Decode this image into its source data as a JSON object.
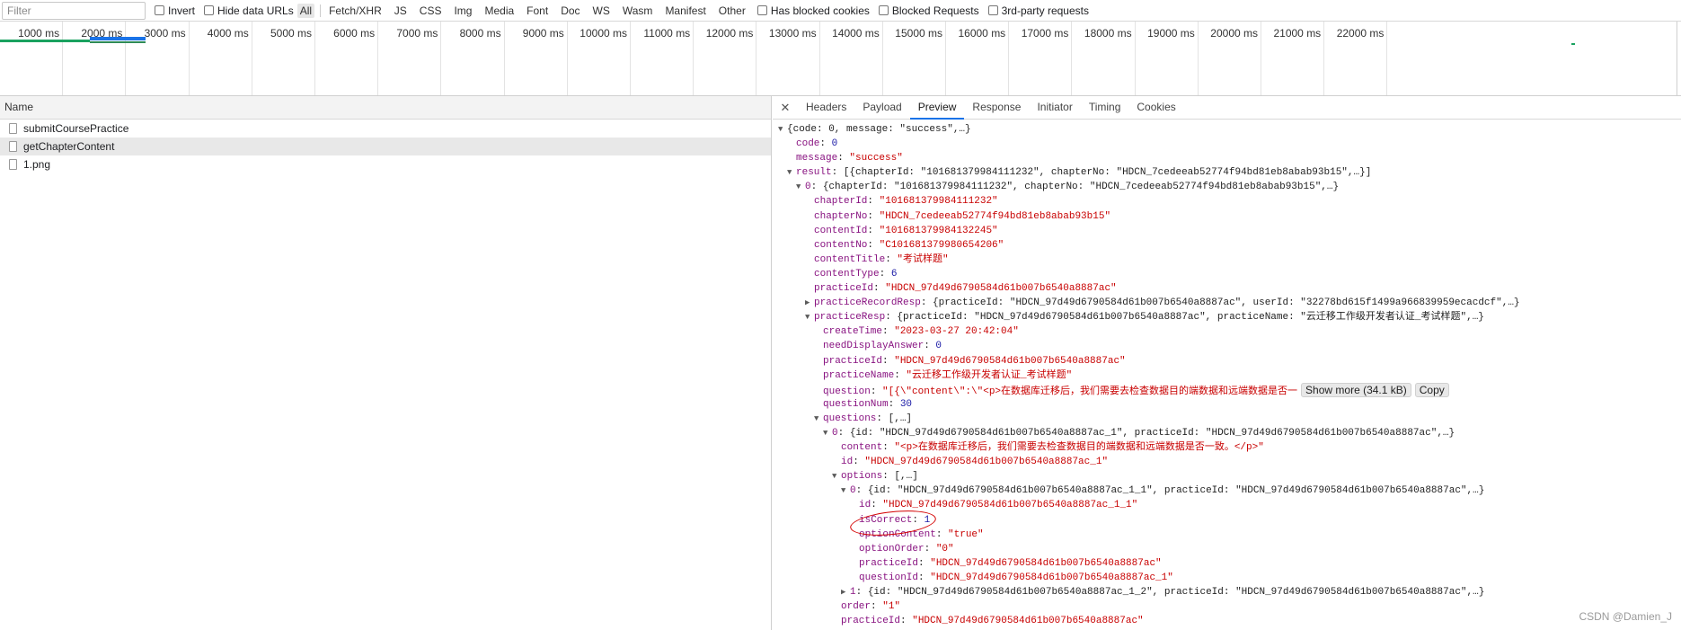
{
  "toolbar": {
    "filter_placeholder": "Filter",
    "invert": "Invert",
    "hide_data_urls": "Hide data URLs",
    "types": [
      "All",
      "Fetch/XHR",
      "JS",
      "CSS",
      "Img",
      "Media",
      "Font",
      "Doc",
      "WS",
      "Wasm",
      "Manifest",
      "Other"
    ],
    "has_blocked_cookies": "Has blocked cookies",
    "blocked_requests": "Blocked Requests",
    "third_party": "3rd-party requests"
  },
  "timeline": {
    "ticks": [
      "1000 ms",
      "2000 ms",
      "3000 ms",
      "4000 ms",
      "5000 ms",
      "6000 ms",
      "7000 ms",
      "8000 ms",
      "9000 ms",
      "10000 ms",
      "11000 ms",
      "12000 ms",
      "13000 ms",
      "14000 ms",
      "15000 ms",
      "16000 ms",
      "17000 ms",
      "18000 ms",
      "19000 ms",
      "20000 ms",
      "21000 ms",
      "22000 ms"
    ]
  },
  "requests": {
    "header": "Name",
    "items": [
      "submitCoursePractice",
      "getChapterContent",
      "1.png"
    ]
  },
  "detail_tabs": [
    "Headers",
    "Payload",
    "Preview",
    "Response",
    "Initiator",
    "Timing",
    "Cookies"
  ],
  "preview": {
    "show_more": "Show more (34.1 kB)",
    "copy": "Copy",
    "lines": [
      {
        "i": 0,
        "t": "down",
        "k": "",
        "v": "{code: 0, message: \"success\",…}",
        "c": "sum"
      },
      {
        "i": 1,
        "t": "",
        "k": "code",
        "v": "0",
        "c": "n"
      },
      {
        "i": 1,
        "t": "",
        "k": "message",
        "v": "\"success\"",
        "c": "s"
      },
      {
        "i": 1,
        "t": "down",
        "k": "result",
        "v": "[{chapterId: \"101681379984111232\", chapterNo: \"HDCN_7cedeeab52774f94bd81eb8abab93b15\",…}]",
        "c": "sum"
      },
      {
        "i": 2,
        "t": "down",
        "k": "0",
        "v": "{chapterId: \"101681379984111232\", chapterNo: \"HDCN_7cedeeab52774f94bd81eb8abab93b15\",…}",
        "c": "sum"
      },
      {
        "i": 3,
        "t": "",
        "k": "chapterId",
        "v": "\"101681379984111232\"",
        "c": "s"
      },
      {
        "i": 3,
        "t": "",
        "k": "chapterNo",
        "v": "\"HDCN_7cedeeab52774f94bd81eb8abab93b15\"",
        "c": "s"
      },
      {
        "i": 3,
        "t": "",
        "k": "contentId",
        "v": "\"101681379984132245\"",
        "c": "s"
      },
      {
        "i": 3,
        "t": "",
        "k": "contentNo",
        "v": "\"C101681379980654206\"",
        "c": "s"
      },
      {
        "i": 3,
        "t": "",
        "k": "contentTitle",
        "v": "\"考试样题\"",
        "c": "s"
      },
      {
        "i": 3,
        "t": "",
        "k": "contentType",
        "v": "6",
        "c": "n"
      },
      {
        "i": 3,
        "t": "",
        "k": "practiceId",
        "v": "\"HDCN_97d49d6790584d61b007b6540a8887ac\"",
        "c": "s"
      },
      {
        "i": 3,
        "t": "right",
        "k": "practiceRecordResp",
        "v": "{practiceId: \"HDCN_97d49d6790584d61b007b6540a8887ac\", userId: \"32278bd615f1499a966839959ecacdcf\",…}",
        "c": "sum"
      },
      {
        "i": 3,
        "t": "down",
        "k": "practiceResp",
        "v": "{practiceId: \"HDCN_97d49d6790584d61b007b6540a8887ac\", practiceName: \"云迁移工作级开发者认证_考试样题\",…}",
        "c": "sum"
      },
      {
        "i": 4,
        "t": "",
        "k": "createTime",
        "v": "\"2023-03-27 20:42:04\"",
        "c": "s"
      },
      {
        "i": 4,
        "t": "",
        "k": "needDisplayAnswer",
        "v": "0",
        "c": "n"
      },
      {
        "i": 4,
        "t": "",
        "k": "practiceId",
        "v": "\"HDCN_97d49d6790584d61b007b6540a8887ac\"",
        "c": "s"
      },
      {
        "i": 4,
        "t": "",
        "k": "practiceName",
        "v": "\"云迁移工作级开发者认证_考试样题\"",
        "c": "s"
      },
      {
        "i": 4,
        "t": "",
        "k": "question",
        "v": "\"[{\\\"content\\\":\\\"<p>在数据库迁移后，我们需要去检查数据目的端数据和远端数据是否一",
        "c": "s",
        "more": true
      },
      {
        "i": 4,
        "t": "",
        "k": "questionNum",
        "v": "30",
        "c": "n"
      },
      {
        "i": 4,
        "t": "down",
        "k": "questions",
        "v": "[,…]",
        "c": "sum"
      },
      {
        "i": 5,
        "t": "down",
        "k": "0",
        "v": "{id: \"HDCN_97d49d6790584d61b007b6540a8887ac_1\", practiceId: \"HDCN_97d49d6790584d61b007b6540a8887ac\",…}",
        "c": "sum"
      },
      {
        "i": 6,
        "t": "",
        "k": "content",
        "v": "\"<p>在数据库迁移后，我们需要去检查数据目的端数据和远端数据是否一致。</p>\"",
        "c": "s"
      },
      {
        "i": 6,
        "t": "",
        "k": "id",
        "v": "\"HDCN_97d49d6790584d61b007b6540a8887ac_1\"",
        "c": "s"
      },
      {
        "i": 6,
        "t": "down",
        "k": "options",
        "v": "[,…]",
        "c": "sum"
      },
      {
        "i": 7,
        "t": "down",
        "k": "0",
        "v": "{id: \"HDCN_97d49d6790584d61b007b6540a8887ac_1_1\", practiceId: \"HDCN_97d49d6790584d61b007b6540a8887ac\",…}",
        "c": "sum"
      },
      {
        "i": 8,
        "t": "",
        "k": "id",
        "v": "\"HDCN_97d49d6790584d61b007b6540a8887ac_1_1\"",
        "c": "s"
      },
      {
        "i": 8,
        "t": "",
        "k": "isCorrect",
        "v": "1",
        "c": "n"
      },
      {
        "i": 8,
        "t": "",
        "k": "optionContent",
        "v": "\"true\"",
        "c": "s"
      },
      {
        "i": 8,
        "t": "",
        "k": "optionOrder",
        "v": "\"0\"",
        "c": "s"
      },
      {
        "i": 8,
        "t": "",
        "k": "practiceId",
        "v": "\"HDCN_97d49d6790584d61b007b6540a8887ac\"",
        "c": "s"
      },
      {
        "i": 8,
        "t": "",
        "k": "questionId",
        "v": "\"HDCN_97d49d6790584d61b007b6540a8887ac_1\"",
        "c": "s"
      },
      {
        "i": 7,
        "t": "right",
        "k": "1",
        "v": "{id: \"HDCN_97d49d6790584d61b007b6540a8887ac_1_2\", practiceId: \"HDCN_97d49d6790584d61b007b6540a8887ac\",…}",
        "c": "sum"
      },
      {
        "i": 6,
        "t": "",
        "k": "order",
        "v": "\"1\"",
        "c": "s"
      },
      {
        "i": 6,
        "t": "",
        "k": "practiceId",
        "v": "\"HDCN_97d49d6790584d61b007b6540a8887ac\"",
        "c": "s"
      }
    ]
  },
  "watermark": "CSDN @Damien_J"
}
